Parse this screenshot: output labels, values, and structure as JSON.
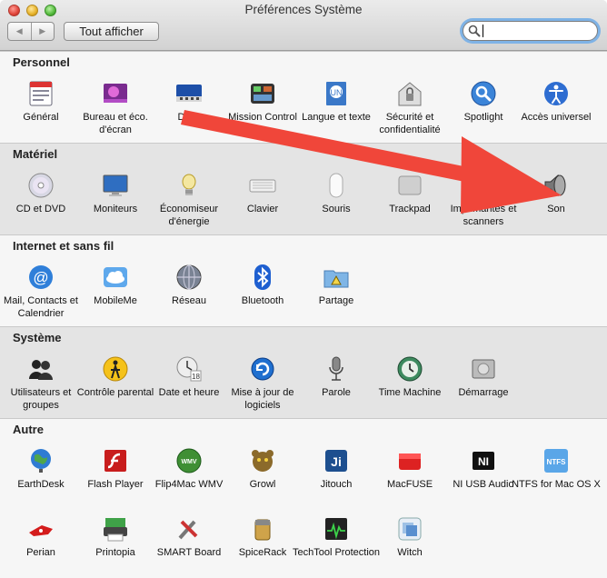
{
  "window": {
    "title": "Préférences Système",
    "show_all_label": "Tout afficher",
    "back_glyph": "◀",
    "forward_glyph": "▶",
    "search": {
      "value": "",
      "placeholder": ""
    }
  },
  "sections": [
    {
      "title": "Personnel",
      "panes": [
        {
          "label": "Général",
          "icon": "general-icon"
        },
        {
          "label": "Bureau et éco. d'écran",
          "icon": "desktop-screensaver-icon"
        },
        {
          "label": "Dock",
          "icon": "dock-icon"
        },
        {
          "label": "Mission Control",
          "icon": "mission-control-icon"
        },
        {
          "label": "Langue et texte",
          "icon": "language-text-icon"
        },
        {
          "label": "Sécurité et confidentialité",
          "icon": "security-icon"
        },
        {
          "label": "Spotlight",
          "icon": "spotlight-icon"
        },
        {
          "label": "Accès universel",
          "icon": "universal-access-icon"
        }
      ]
    },
    {
      "title": "Matériel",
      "panes": [
        {
          "label": "CD et DVD",
          "icon": "cd-dvd-icon"
        },
        {
          "label": "Moniteurs",
          "icon": "displays-icon"
        },
        {
          "label": "Économiseur d'énergie",
          "icon": "energy-saver-icon"
        },
        {
          "label": "Clavier",
          "icon": "keyboard-icon"
        },
        {
          "label": "Souris",
          "icon": "mouse-icon"
        },
        {
          "label": "Trackpad",
          "icon": "trackpad-icon"
        },
        {
          "label": "Imprimantes et scanners",
          "icon": "printers-scanners-icon"
        },
        {
          "label": "Son",
          "icon": "sound-icon"
        }
      ]
    },
    {
      "title": "Internet et sans fil",
      "panes": [
        {
          "label": "Mail, Contacts et Calendrier",
          "icon": "mail-contacts-icon"
        },
        {
          "label": "MobileMe",
          "icon": "mobileme-icon"
        },
        {
          "label": "Réseau",
          "icon": "network-icon"
        },
        {
          "label": "Bluetooth",
          "icon": "bluetooth-icon"
        },
        {
          "label": "Partage",
          "icon": "sharing-icon"
        }
      ]
    },
    {
      "title": "Système",
      "panes": [
        {
          "label": "Utilisateurs et groupes",
          "icon": "users-groups-icon"
        },
        {
          "label": "Contrôle parental",
          "icon": "parental-controls-icon"
        },
        {
          "label": "Date et heure",
          "icon": "date-time-icon"
        },
        {
          "label": "Mise à jour de logiciels",
          "icon": "software-update-icon"
        },
        {
          "label": "Parole",
          "icon": "speech-icon"
        },
        {
          "label": "Time Machine",
          "icon": "time-machine-icon"
        },
        {
          "label": "Démarrage",
          "icon": "startup-disk-icon"
        }
      ]
    },
    {
      "title": "Autre",
      "panes": [
        {
          "label": "EarthDesk",
          "icon": "earthdesk-icon"
        },
        {
          "label": "Flash Player",
          "icon": "flash-player-icon"
        },
        {
          "label": "Flip4Mac WMV",
          "icon": "flip4mac-icon"
        },
        {
          "label": "Growl",
          "icon": "growl-icon"
        },
        {
          "label": "Jitouch",
          "icon": "jitouch-icon"
        },
        {
          "label": "MacFUSE",
          "icon": "macfuse-icon"
        },
        {
          "label": "NI USB Audio",
          "icon": "ni-usb-audio-icon"
        },
        {
          "label": "NTFS for Mac OS X",
          "icon": "ntfs-icon"
        },
        {
          "label": "Perian",
          "icon": "perian-icon"
        },
        {
          "label": "Printopia",
          "icon": "printopia-icon"
        },
        {
          "label": "SMART Board",
          "icon": "smart-board-icon"
        },
        {
          "label": "SpiceRack",
          "icon": "spicerack-icon"
        },
        {
          "label": "TechTool Protection",
          "icon": "techtool-icon"
        },
        {
          "label": "Witch",
          "icon": "witch-icon"
        }
      ]
    }
  ],
  "annotation": {
    "arrow_color": "#f0463a",
    "icon": "red-arrow-annotation"
  }
}
